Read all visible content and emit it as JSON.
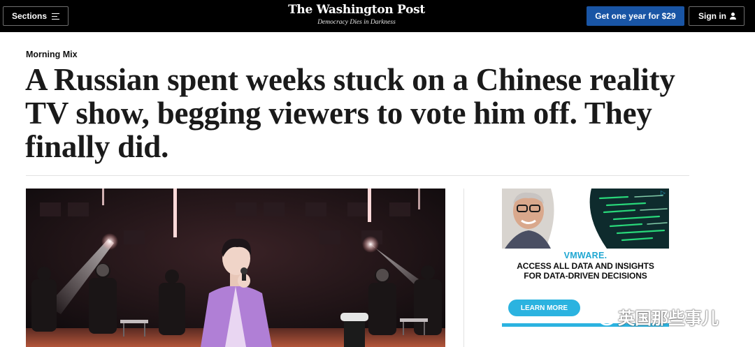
{
  "topbar": {
    "sections_label": "Sections",
    "sections_icon": "hamburger-menu-icon",
    "logo_text": "The Washington Post",
    "tagline": "Democracy Dies in Darkness",
    "subscribe_label": "Get one year for $29",
    "signin_label": "Sign in",
    "signin_icon": "user-icon",
    "colors": {
      "background": "#000000",
      "subscribe": "#1955a5"
    }
  },
  "article": {
    "kicker": "Morning Mix",
    "headline": "A Russian spent weeks stuck on a Chinese reality TV show, begging viewers to vote him off. They finally did."
  },
  "ad": {
    "choices_icon": "ad-choices-icon",
    "brand": "VMWARE.",
    "line1": "ACCESS ALL DATA AND INSIGHTS",
    "line2": "FOR DATA-DRIVEN DECISIONS",
    "cta": "LEARN MORE",
    "accent": "#2bb3e0"
  },
  "watermark": {
    "icon": "wechat-icon",
    "text": "英国那些事儿"
  }
}
